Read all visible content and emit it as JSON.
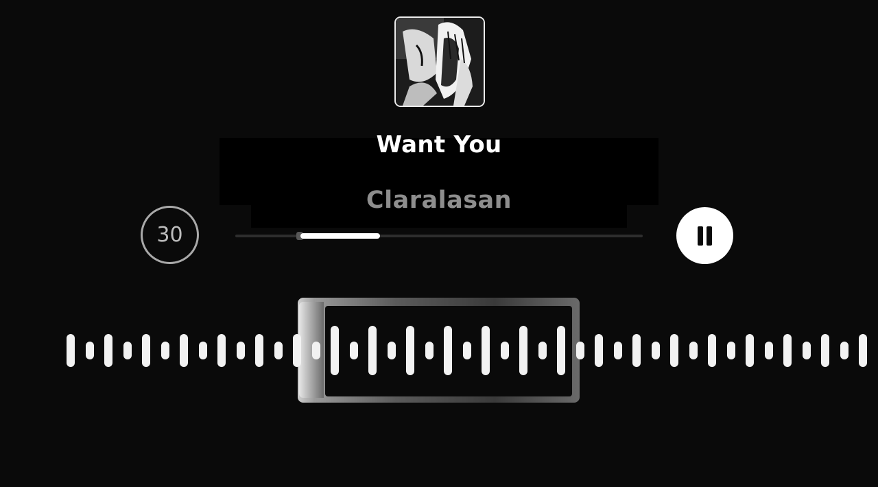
{
  "track": {
    "title": "Want You",
    "artist": "Claralasan"
  },
  "duration_selector": {
    "value": "30"
  },
  "playback": {
    "state": "playing",
    "control_icon": "pause-icon",
    "progress_fraction": 0.2
  },
  "waveform": {
    "selection_icon": "trim-selection-frame"
  },
  "colors": {
    "background": "#0a0a0a",
    "title": "#ffffff",
    "artist": "#8e8e8e",
    "accent": "#ffffff"
  }
}
